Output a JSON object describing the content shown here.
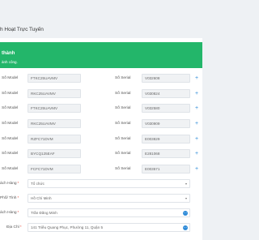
{
  "page": {
    "title": "h Hoạt Trực Tuyến"
  },
  "banner": {
    "title": "thành",
    "message": "ành công."
  },
  "product_rows": [
    {
      "model_label": "Số Model",
      "model_value": "FTKC25UAVMV",
      "serial_label": "Số Serial",
      "serial_value": "V032608"
    },
    {
      "model_label": "Số Model",
      "model_value": "RKC25UAVMV",
      "serial_label": "Số Serial",
      "serial_value": "V030824"
    },
    {
      "model_label": "Số Model",
      "model_value": "FTKC25UAVMV",
      "serial_label": "Số Serial",
      "serial_value": "V032580"
    },
    {
      "model_label": "Số Model",
      "model_value": "RKC25UAVMV",
      "serial_label": "Số Serial",
      "serial_value": "V030909"
    },
    {
      "model_label": "Số Model",
      "model_value": "RZFC71DVM",
      "serial_label": "Số Serial",
      "serial_value": "E003829"
    },
    {
      "model_label": "Số Model",
      "model_value": "BYCQ125EAF",
      "serial_label": "Số Serial",
      "serial_value": "E281068"
    },
    {
      "model_label": "Số Model",
      "model_value": "FCFC71DVM",
      "serial_label": "Số Serial",
      "serial_value": "E003571"
    }
  ],
  "plus_symbol": "+",
  "required_mark": "*",
  "customer": {
    "type_label": "ách Hàng",
    "type_value": "Tổ chức",
    "city_label": "Phố/ Tỉnh",
    "city_value": "Hồ Chí Minh",
    "name_label": "ách Hàng",
    "name_value": "Trần Đăng Minh",
    "address_label": "Địa Chỉ",
    "address_value": "141 Triều Quang Phục, Phường 11, Quận 5",
    "dropdown_arrow": "▾",
    "badge_text": "⋯"
  },
  "colors": {
    "banner": "#23b66a",
    "accent": "#2e8bd8",
    "required": "#e74c3c"
  }
}
